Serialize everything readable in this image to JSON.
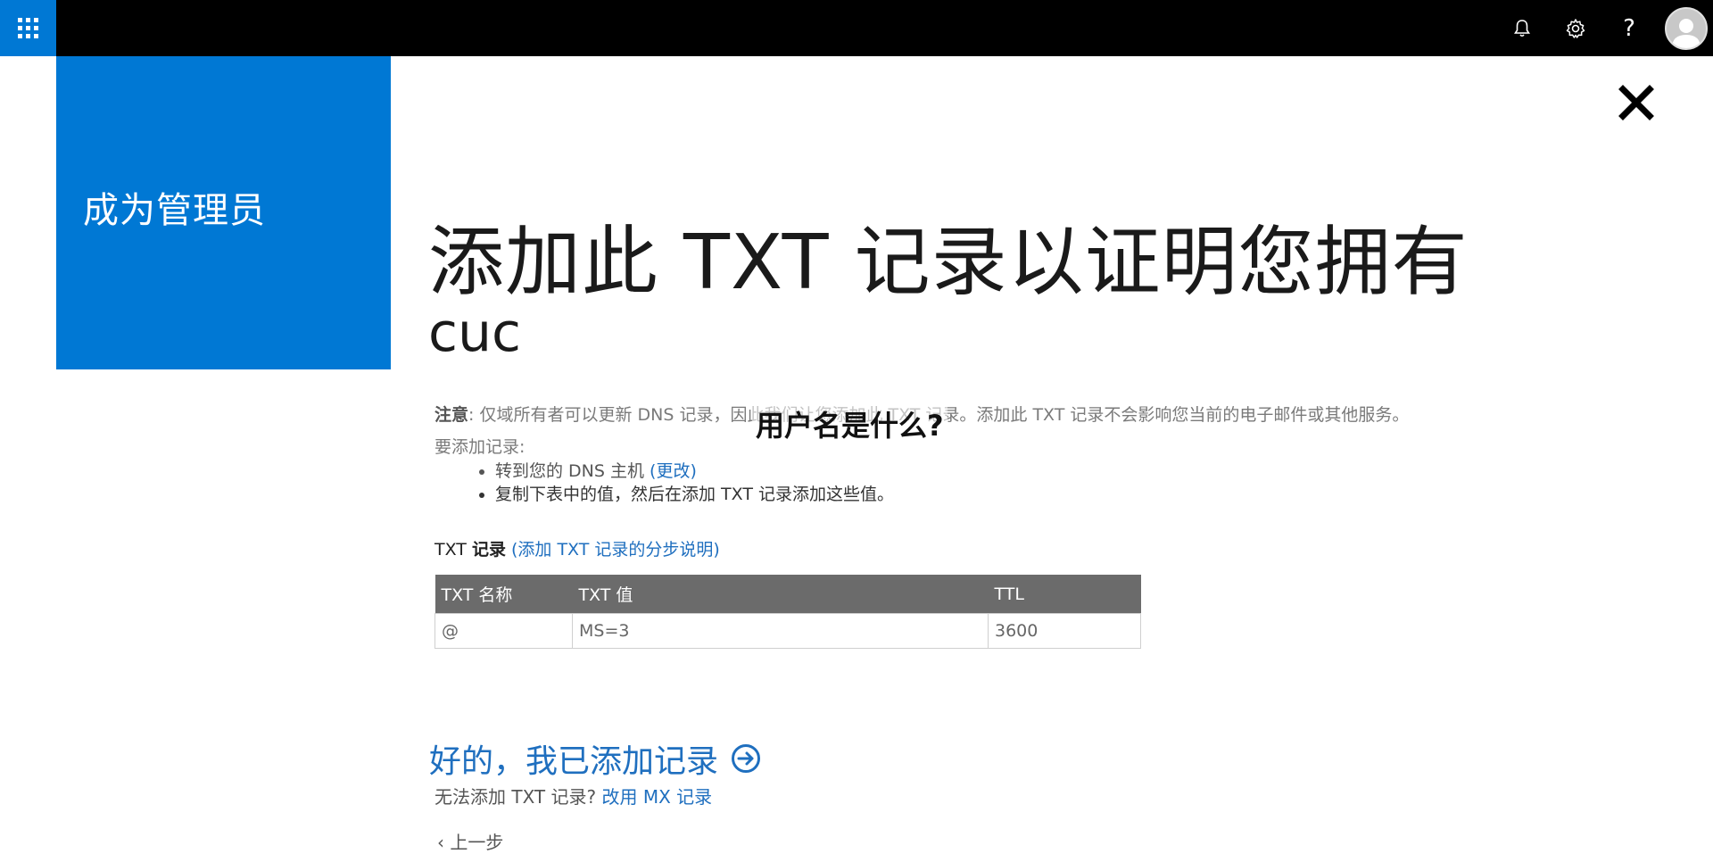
{
  "topbar": {
    "waffle_icon": "app-launcher-icon",
    "bell_icon": "bell-icon",
    "gear_icon": "gear-icon",
    "help_label": "?",
    "avatar_icon": "avatar-icon"
  },
  "left_panel": {
    "title": "成为管理员",
    "color": "#0078d4"
  },
  "main": {
    "heading": "添加此 TXT 记录以证明您拥有",
    "domain": "cuc",
    "note_label": "注意",
    "note_text": ": 仅域所有者可以更新 DNS 记录，因此我们让您添加此 TXT 记录。添加此 TXT 记录不会影响您当前的电子邮件或其他服务。",
    "add_intro": "要添加记录:",
    "steps": [
      {
        "text": "转到您的 DNS 主机 ",
        "link": "(更改)"
      },
      {
        "text": "复制下表中的值，然后在添加 TXT 记录添加这些值。"
      }
    ],
    "txt_label_plain": "TXT ",
    "txt_label_bold": "记录",
    "txt_help_link": " (添加 TXT 记录的分步说明)",
    "table": {
      "headers": [
        "TXT 名称",
        "TXT 值",
        "TTL"
      ],
      "rows": [
        [
          "@",
          "MS=3",
          "3600"
        ]
      ]
    },
    "done_button": "好的，我已添加记录",
    "mx_prefix": "无法添加 TXT 记录? ",
    "mx_link": "改用 MX 记录",
    "back_label": "上一步"
  },
  "overlay": {
    "question": "用户名是什么?"
  },
  "colors": {
    "accent": "#0078d4",
    "link": "#1f6fbf",
    "topbar": "#000000",
    "table_header": "#6b6b6b"
  }
}
